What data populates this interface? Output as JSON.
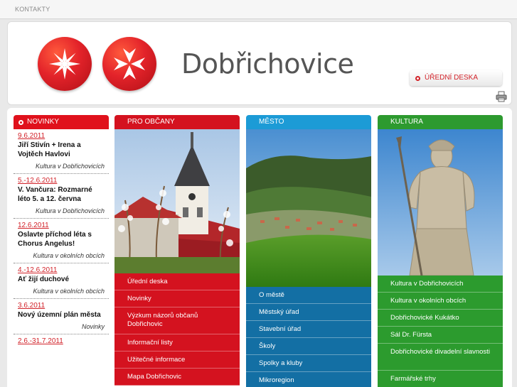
{
  "topbar": {
    "contacts": "KONTAKTY"
  },
  "header": {
    "town_name": "Dobřichovice",
    "official_board": "ÚŘEDNÍ DESKA",
    "icons": [
      "town-emblem-star",
      "town-emblem-cross",
      "printer-icon"
    ]
  },
  "news": {
    "title": "NOVINKY",
    "items": [
      {
        "date": "9.6.2011",
        "title": "Jiří Stivín + Irena a Vojtěch Havlovi",
        "category": "Kultura v Dobřichovicích"
      },
      {
        "date": "5.-12.6.2011",
        "title": "V. Vančura: Rozmarné léto 5. a 12. června",
        "category": "Kultura v Dobřichovicích"
      },
      {
        "date": "12.6.2011",
        "title": "Oslavte příchod léta s Chorus Angelus!",
        "category": "Kultura v okolních obcích"
      },
      {
        "date": "4.-12.6.2011",
        "title": "Ať žijí duchové",
        "category": "Kultura v okolních obcích"
      },
      {
        "date": "3.6.2011",
        "title": "Nový územní plán města",
        "category": "Novinky"
      },
      {
        "date": "2.6.-31.7.2011",
        "title": "",
        "category": ""
      }
    ]
  },
  "columns": {
    "citizens": {
      "title": "PRO OBČANY",
      "items": [
        "Úřední deska",
        "Novinky",
        "Výzkum názorů občanů Dobřichovic",
        "Informační listy",
        "Užitečné informace",
        "Mapa Dobřichovic"
      ]
    },
    "town": {
      "title": "MĚSTO",
      "items": [
        "O městě",
        "Městský úřad",
        "Stavební úřad",
        "Školy",
        "Spolky a kluby",
        "Mikroregion"
      ]
    },
    "culture": {
      "title": "KULTURA",
      "items": [
        "Kultura v Dobřichovicích",
        "Kultura v okolních obcích",
        "Dobřichovické Kukátko",
        "Sál Dr. Fürsta",
        "Dobřichovické divadelní slavnosti",
        "Farmářské trhy"
      ]
    }
  },
  "colors": {
    "red": "#d4121f",
    "blue": "#1c9bd6",
    "dark_blue": "#136fa4",
    "green": "#2d9a2f"
  }
}
